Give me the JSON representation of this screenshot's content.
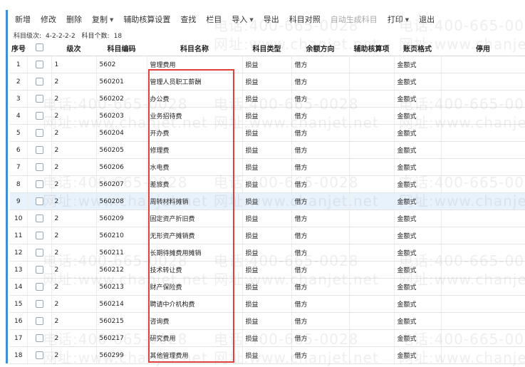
{
  "toolbar": {
    "items": [
      {
        "label": "新增",
        "dropdown": false,
        "disabled": false
      },
      {
        "label": "修改",
        "dropdown": false,
        "disabled": false
      },
      {
        "label": "删除",
        "dropdown": false,
        "disabled": false
      },
      {
        "label": "复制",
        "dropdown": true,
        "disabled": false
      },
      {
        "label": "辅助核算设置",
        "dropdown": false,
        "disabled": false
      },
      {
        "label": "查找",
        "dropdown": false,
        "disabled": false
      },
      {
        "label": "栏目",
        "dropdown": false,
        "disabled": false
      },
      {
        "label": "导入",
        "dropdown": true,
        "disabled": false
      },
      {
        "label": "导出",
        "dropdown": false,
        "disabled": false
      },
      {
        "label": "科目对照",
        "dropdown": false,
        "disabled": false
      },
      {
        "label": "自动生成科目",
        "dropdown": false,
        "disabled": true
      },
      {
        "label": "打印",
        "dropdown": true,
        "disabled": false
      },
      {
        "label": "退出",
        "dropdown": false,
        "disabled": false
      }
    ]
  },
  "subinfo": {
    "level_label": "科目级次:",
    "level_value": "4-2-2-2-2",
    "count_label": "科目个数:",
    "count_value": "18"
  },
  "table": {
    "headers": [
      "序号",
      "",
      "级次",
      "科目编码",
      "科目名称",
      "科目类型",
      "余额方向",
      "辅助核算项",
      "账页格式",
      "停用"
    ],
    "rows": [
      [
        "1",
        "1",
        "5602",
        "管理费用",
        "损益",
        "借方",
        "",
        "金额式",
        ""
      ],
      [
        "2",
        "2",
        "560201",
        "管理人员职工薪酬",
        "损益",
        "借方",
        "",
        "金额式",
        ""
      ],
      [
        "3",
        "2",
        "560202",
        "办公费",
        "损益",
        "借方",
        "",
        "金额式",
        ""
      ],
      [
        "4",
        "2",
        "560203",
        "业务招待费",
        "损益",
        "借方",
        "",
        "金额式",
        ""
      ],
      [
        "5",
        "2",
        "560204",
        "开办费",
        "损益",
        "借方",
        "",
        "金额式",
        ""
      ],
      [
        "6",
        "2",
        "560205",
        "修理费",
        "损益",
        "借方",
        "",
        "金额式",
        ""
      ],
      [
        "7",
        "2",
        "560206",
        "水电费",
        "损益",
        "借方",
        "",
        "金额式",
        ""
      ],
      [
        "8",
        "2",
        "560207",
        "差旅费",
        "损益",
        "借方",
        "",
        "金额式",
        ""
      ],
      [
        "9",
        "2",
        "560208",
        "周转材料摊销",
        "损益",
        "借方",
        "",
        "金额式",
        ""
      ],
      [
        "10",
        "2",
        "560209",
        "固定资产折旧费",
        "损益",
        "借方",
        "",
        "金额式",
        ""
      ],
      [
        "11",
        "2",
        "560210",
        "无形资产摊销费",
        "损益",
        "借方",
        "",
        "金额式",
        ""
      ],
      [
        "12",
        "2",
        "560211",
        "长期待摊费用摊销",
        "损益",
        "借方",
        "",
        "金额式",
        ""
      ],
      [
        "13",
        "2",
        "560212",
        "技术转让费",
        "损益",
        "借方",
        "",
        "金额式",
        ""
      ],
      [
        "14",
        "2",
        "560213",
        "财产保险费",
        "损益",
        "借方",
        "",
        "金额式",
        ""
      ],
      [
        "15",
        "2",
        "560214",
        "聘请中介机构费",
        "损益",
        "借方",
        "",
        "金额式",
        ""
      ],
      [
        "16",
        "2",
        "560215",
        "咨询费",
        "损益",
        "借方",
        "",
        "金额式",
        ""
      ],
      [
        "17",
        "2",
        "560217",
        "研究费用",
        "损益",
        "借方",
        "",
        "金额式",
        ""
      ],
      [
        "18",
        "2",
        "560299",
        "其他管理费用",
        "损益",
        "借方",
        "",
        "金额式",
        ""
      ]
    ],
    "selected_row_index": 8
  },
  "watermark": {
    "phone": "电话:400-665-0028",
    "site": "网址:www.chanjet.net"
  },
  "colors": {
    "highlight_box": "#e0403a",
    "selected_row": "#e8f2fd",
    "accent_bar": "#3d8fd8"
  }
}
